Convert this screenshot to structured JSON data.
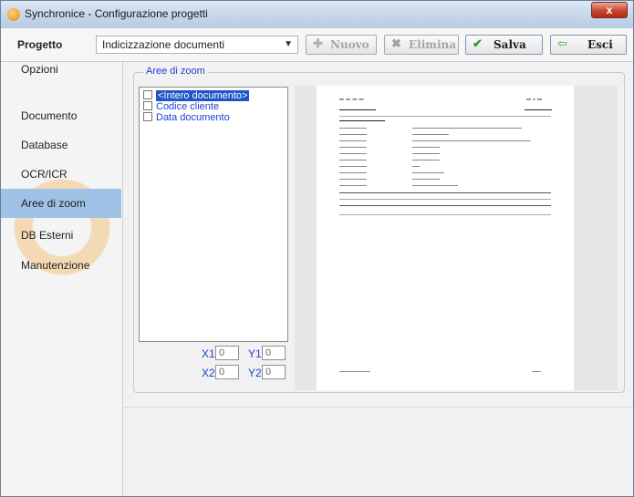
{
  "window": {
    "title": "Synchronice - Configurazione progetti",
    "close_label": "x"
  },
  "toolbar": {
    "project_label": "Progetto",
    "project_selected": "Indicizzazione documenti",
    "buttons": {
      "new_label": "Nuovo",
      "delete_label": "Elimina",
      "save_label": "Salva",
      "exit_label": "Esci"
    }
  },
  "sidebar": {
    "items": [
      {
        "label": "Opzioni"
      },
      {
        "label": "Documento"
      },
      {
        "label": "Database"
      },
      {
        "label": "OCR/ICR"
      },
      {
        "label": "Aree di zoom"
      },
      {
        "label": "DB Esterni"
      },
      {
        "label": "Manutenzione"
      }
    ],
    "selected": "Aree di zoom"
  },
  "zoom": {
    "group_label": "Aree di zoom",
    "areas": [
      {
        "label": "<Intero documento>",
        "selected": true
      },
      {
        "label": "Codice cliente",
        "selected": false
      },
      {
        "label": "Data documento",
        "selected": false
      }
    ],
    "coords": {
      "x1_label": "X1",
      "x1": "0",
      "y1_label": "Y1",
      "y1": "0",
      "x2_label": "X2",
      "x2": "0",
      "y2_label": "Y2",
      "y2": "0"
    }
  },
  "colors": {
    "accent_blue": "#1e3fd1",
    "sidebar_selected": "#9fc2e6",
    "close_red": "#c9432e"
  },
  "icons": {
    "new": "plus-icon",
    "delete": "x-icon",
    "save": "check-icon",
    "exit": "exit-icon"
  }
}
